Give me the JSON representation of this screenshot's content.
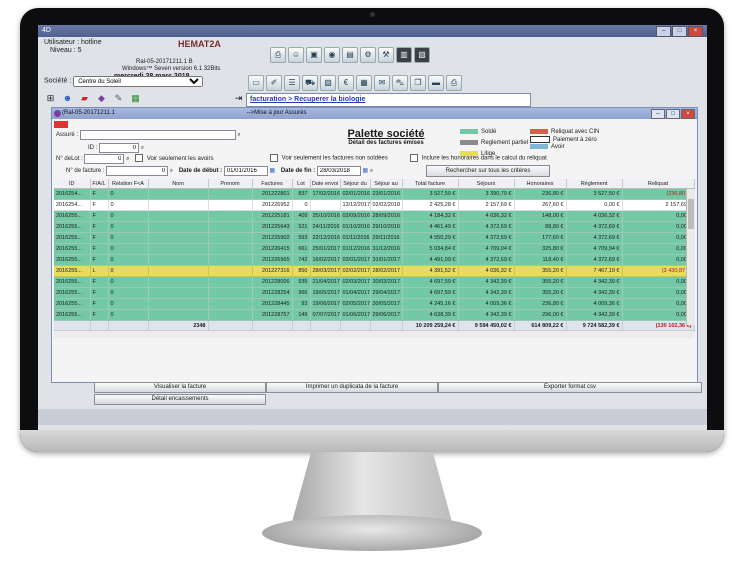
{
  "app": {
    "window_title": "4D",
    "user_label": "Utilisateur : hotline",
    "niveau_label": "Niveau : 5",
    "date": "mercredi 28 mars 2018",
    "os_info": "Windows™ Seven version 6.1 32Bits",
    "version": "Ral-05-20171211.1 B",
    "societe_label": "Société :",
    "societe_value": "Centre du Soleil",
    "logo": "HEMAT2A",
    "breadcrumb": "facturation > Recuperer la biologie"
  },
  "palette": {
    "window_title": "(Ral-05-20171211.1",
    "status_msg": "-->Mise à jour Assurés",
    "title": "Palette société",
    "subtitle": "Détail des factures émises",
    "filters": {
      "assure_label": "Assuré :",
      "id_label": "ID :",
      "id_value": "0",
      "delot_label": "N° deLot :",
      "delot_value": "0",
      "facture_label": "N° de facture :",
      "facture_value": "0",
      "voir_avoirs": "Voir seulement les avoirs",
      "voir_non_soldees": "Voir seulement les factures non soldées",
      "inclure_honoraires": "Inclure les honoraires dans le calcul du reliquat",
      "date_debut_label": "Date de début :",
      "date_debut_value": "01/01/2016",
      "date_fin_label": "Date de fin :",
      "date_fin_value": "28/03/2018",
      "search_button": "Rechercher sur tous les critères"
    },
    "legend": [
      {
        "label": "Soldé",
        "color": "#73c8a5"
      },
      {
        "label": "Reglement partiel",
        "color": "#8a8a8a"
      },
      {
        "label": "Litige",
        "color": "#e7dc5b"
      },
      {
        "label": "Reliquat avec CIN",
        "color": "#e05a4a"
      },
      {
        "label": "Paiement à zéro",
        "color": "#ffffff"
      },
      {
        "label": "Avoir",
        "color": "#7fb6d6"
      }
    ],
    "columns": [
      "ID",
      "F/A/L",
      "Relation F<A",
      "Nom",
      "Prenom",
      "Factures",
      "Lot",
      "Date envoi",
      "Séjour du",
      "Séjour au",
      "Total facture",
      "Séjours",
      "Honoraires",
      "Règlement",
      "Reliquat"
    ],
    "rows": [
      {
        "style": "green",
        "cells": [
          "2016254...",
          "F",
          "0",
          "",
          "",
          "201222801",
          "837",
          "17/02/2016",
          "02/01/2016",
          "23/01/2016",
          "3 527,50 €",
          "3 390,70 €",
          "236,80 €",
          "3 527,50 €",
          "(236,80 €)"
        ]
      },
      {
        "style": "white",
        "cells": [
          "2016254...",
          "F",
          "0",
          "",
          "",
          "201226952",
          "0",
          "",
          "13/12/2017",
          "02/02/2018",
          "2 425,28 €",
          "2 157,69 €",
          "267,60 €",
          "0,00 €",
          "2 157,69 €"
        ]
      },
      {
        "style": "green",
        "cells": [
          "2016255...",
          "F",
          "0",
          "",
          "",
          "201225181",
          "409",
          "25/10/2016",
          "03/09/2016",
          "28/09/2016",
          "4 184,32 €",
          "4 036,32 €",
          "148,00 €",
          "4 036,32 €",
          "0,00 €"
        ]
      },
      {
        "style": "green",
        "cells": [
          "2016255...",
          "F",
          "0",
          "",
          "",
          "201225643",
          "521",
          "24/11/2016",
          "01/10/2016",
          "29/10/2016",
          "4 461,49 €",
          "4 372,69 €",
          "88,80 €",
          "4 372,69 €",
          "0,00 €"
        ]
      },
      {
        "style": "green",
        "cells": [
          "2016255...",
          "F",
          "0",
          "",
          "",
          "201225902",
          "593",
          "22/12/2016",
          "01/11/2016",
          "29/11/2016",
          "4 550,29 €",
          "4 372,69 €",
          "177,60 €",
          "4 372,69 €",
          "0,00 €"
        ]
      },
      {
        "style": "green",
        "cells": [
          "2016255...",
          "F",
          "0",
          "",
          "",
          "201226415",
          "661",
          "25/01/2017",
          "01/12/2016",
          "31/12/2016",
          "5 034,84 €",
          "4 709,04 €",
          "325,80 €",
          "4 709,04 €",
          "0,00 €"
        ]
      },
      {
        "style": "green",
        "cells": [
          "2016255...",
          "F",
          "0",
          "",
          "",
          "201226965",
          "742",
          "16/02/2017",
          "03/01/2017",
          "31/01/2017",
          "4 491,09 €",
          "4 372,69 €",
          "118,40 €",
          "4 372,69 €",
          "0,00 €"
        ]
      },
      {
        "style": "yellow",
        "cells": [
          "2016255...",
          "L",
          "0",
          "",
          "",
          "201227316",
          "850",
          "28/03/2017",
          "02/02/2017",
          "28/02/2017",
          "4 391,52 €",
          "4 036,32 €",
          "355,20 €",
          "7 467,19 €",
          "(3 430,87 €)"
        ]
      },
      {
        "style": "green",
        "cells": [
          "2016255...",
          "F",
          "0",
          "",
          "",
          "201228006",
          "935",
          "21/04/2017",
          "02/03/2017",
          "30/03/2017",
          "4 697,59 €",
          "4 342,39 €",
          "355,20 €",
          "4 342,39 €",
          "0,00 €"
        ]
      },
      {
        "style": "green",
        "cells": [
          "2016255...",
          "F",
          "0",
          "",
          "",
          "201228254",
          "966",
          "19/05/2017",
          "01/04/2017",
          "29/04/2017",
          "4 697,59 €",
          "4 342,39 €",
          "355,20 €",
          "4 342,39 €",
          "0,00 €"
        ]
      },
      {
        "style": "green",
        "cells": [
          "2016255...",
          "F",
          "0",
          "",
          "",
          "201228445",
          "93",
          "19/06/2017",
          "02/05/2017",
          "30/05/2017",
          "4 245,16 €",
          "4 009,36 €",
          "236,80 €",
          "4 009,36 €",
          "0,00 €"
        ]
      },
      {
        "style": "green",
        "cells": [
          "2016255...",
          "F",
          "0",
          "",
          "",
          "201228757",
          "149",
          "07/07/2017",
          "01/06/2017",
          "29/06/2017",
          "4 638,39 €",
          "4 342,39 €",
          "296,00 €",
          "4 342,39 €",
          "0,00 €"
        ]
      }
    ],
    "totals": [
      "",
      "",
      "",
      "2348",
      "",
      "",
      "",
      "",
      "",
      "",
      "10 209 259,24 €",
      "9 594 450,02 €",
      "614 809,22 €",
      "9 724 582,39 €",
      "(130 102,36 €)"
    ],
    "buttons": {
      "visualiser": "Visualiser la facture",
      "imprimer": "Imprimer un duplicata de la facture",
      "exporter": "Exporter format csv",
      "encaissements": "Détail encaissements"
    }
  }
}
